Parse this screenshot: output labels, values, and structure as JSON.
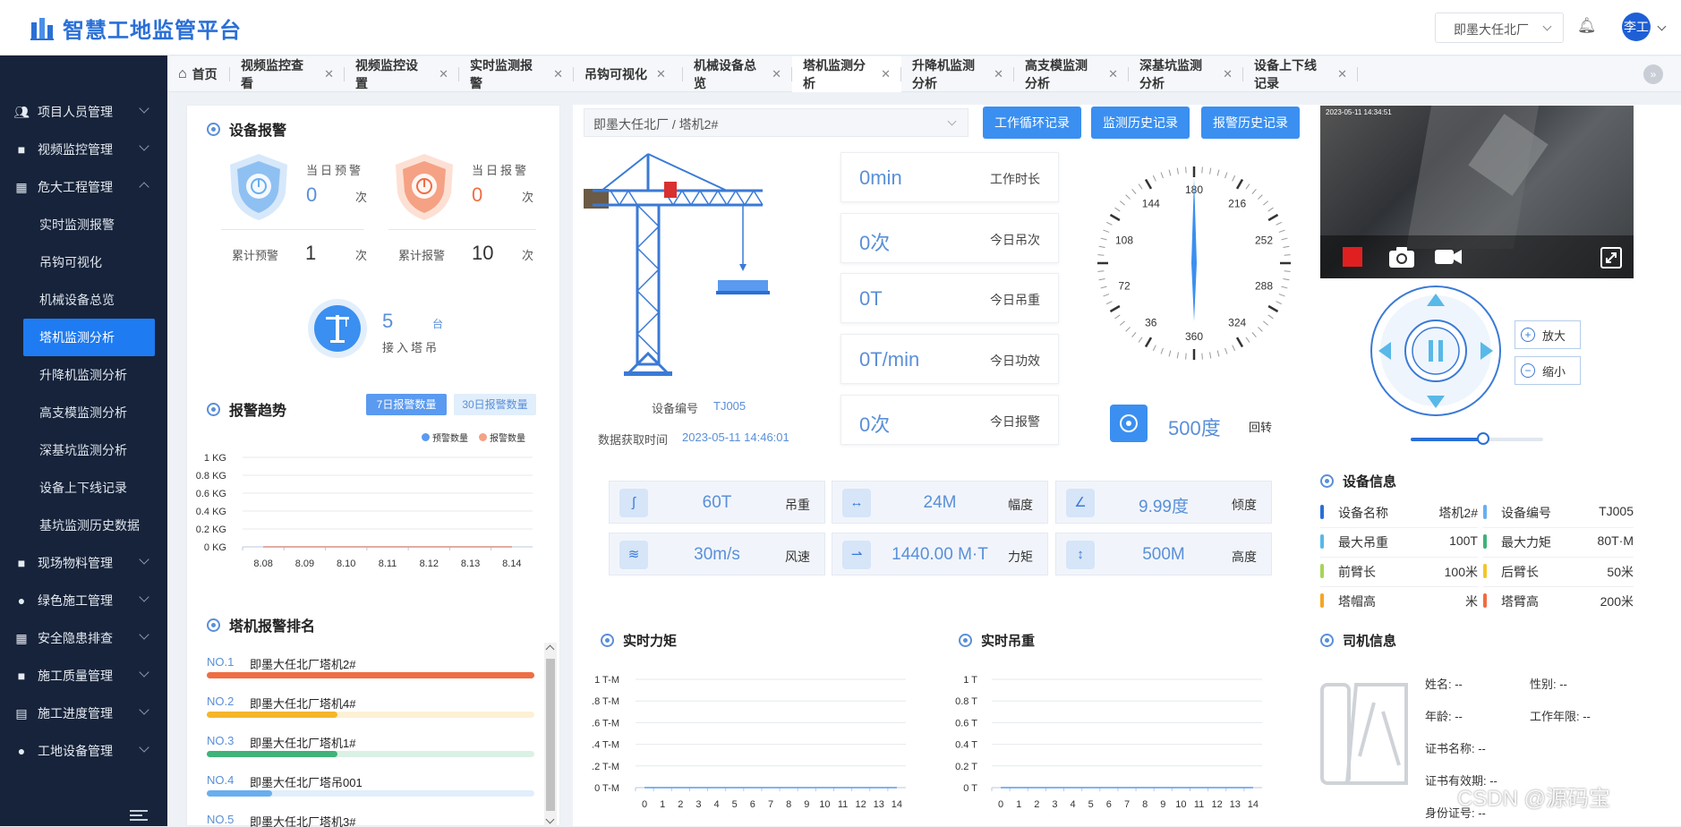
{
  "header": {
    "brand": "智慧工地监管平台",
    "site_select": "即墨大任北厂",
    "user": "李工"
  },
  "sidebar": {
    "items": [
      {
        "label": "项目人员管理",
        "icon": "people-icon",
        "expanded": false
      },
      {
        "label": "视频监控管理",
        "icon": "cube-icon",
        "expanded": false
      },
      {
        "label": "危大工程管理",
        "icon": "building-icon",
        "expanded": true
      }
    ],
    "sub_items": [
      "实时监测报警",
      "吊钩可视化",
      "机械设备总览",
      "塔机监测分析",
      "升降机监测分析",
      "高支模监测分析",
      "深基坑监测分析",
      "设备上下线记录",
      "基坑监测历史数据"
    ],
    "active_sub": "塔机监测分析",
    "more_items": [
      {
        "label": "现场物料管理",
        "icon": "cube-icon"
      },
      {
        "label": "绿色施工管理",
        "icon": "person-icon"
      },
      {
        "label": "安全隐患排查",
        "icon": "building-icon"
      },
      {
        "label": "施工质量管理",
        "icon": "cube-icon"
      },
      {
        "label": "施工进度管理",
        "icon": "schedule-icon"
      },
      {
        "label": "工地设备管理",
        "icon": "person-icon"
      }
    ]
  },
  "tabs": [
    {
      "label": "首页",
      "closable": false
    },
    {
      "label": "视频监控查看",
      "closable": true
    },
    {
      "label": "视频监控设置",
      "closable": true
    },
    {
      "label": "实时监测报警",
      "closable": true
    },
    {
      "label": "吊钩可视化",
      "closable": true
    },
    {
      "label": "机械设备总览",
      "closable": true
    },
    {
      "label": "塔机监测分析",
      "closable": true,
      "active": true
    },
    {
      "label": "升降机监测分析",
      "closable": true
    },
    {
      "label": "高支模监测分析",
      "closable": true
    },
    {
      "label": "深基坑监测分析",
      "closable": true
    },
    {
      "label": "设备上下线记录",
      "closable": true
    }
  ],
  "alarm": {
    "title": "设备报警",
    "daily_warning_label": "当日预警",
    "daily_warning_value": "0",
    "daily_alarm_label": "当日报警",
    "daily_alarm_value": "0",
    "unit": "次",
    "total_warning_label": "累计预警",
    "total_warning_value": "1",
    "total_alarm_label": "累计报警",
    "total_alarm_value": "10",
    "cranes_value": "5",
    "cranes_unit": "台",
    "cranes_label": "接入塔吊"
  },
  "trend": {
    "title": "报警趋势",
    "btn_7": "7日报警数量",
    "btn_30": "30日报警数量",
    "legend_warning": "预警数量",
    "legend_alarm": "报警数量"
  },
  "chart_data": [
    {
      "type": "line",
      "categories": [
        "8.08",
        "8.09",
        "8.10",
        "8.11",
        "8.12",
        "8.13",
        "8.14"
      ],
      "series": [
        {
          "name": "预警数量",
          "values": [
            0,
            0,
            0,
            0,
            0,
            0,
            0
          ]
        },
        {
          "name": "报警数量",
          "values": [
            0,
            0,
            0,
            0,
            0,
            0,
            0
          ]
        }
      ],
      "yticks": [
        "1 KG",
        "0.8 KG",
        "0.6 KG",
        "0.4 KG",
        "0.2 KG",
        "0 KG"
      ],
      "title": "报警趋势",
      "ylim": [
        0,
        1
      ]
    },
    {
      "type": "line",
      "categories": [
        "0",
        "1",
        "2",
        "3",
        "4",
        "5",
        "6",
        "7",
        "8",
        "9",
        "10",
        "11",
        "12",
        "13",
        "14"
      ],
      "series": [
        {
          "values": [
            0,
            0,
            0,
            0,
            0,
            0,
            0,
            0,
            0,
            0,
            0,
            0,
            0,
            0,
            0
          ]
        }
      ],
      "yticks": [
        "1 T-M",
        ".8 T-M",
        ".6 T-M",
        ".4 T-M",
        ".2 T-M",
        "0 T-M"
      ],
      "title": "实时力矩",
      "ylim": [
        0,
        1
      ]
    },
    {
      "type": "line",
      "categories": [
        "0",
        "1",
        "2",
        "3",
        "4",
        "5",
        "6",
        "7",
        "8",
        "9",
        "10",
        "11",
        "12",
        "13",
        "14"
      ],
      "series": [
        {
          "values": [
            0,
            0,
            0,
            0,
            0,
            0,
            0,
            0,
            0,
            0,
            0,
            0,
            0,
            0,
            0
          ]
        }
      ],
      "yticks": [
        "1 T",
        "0.8 T",
        "0.6 T",
        "0.4 T",
        "0.2 T",
        "0 T"
      ],
      "title": "实时吊重",
      "ylim": [
        0,
        1
      ]
    }
  ],
  "ranking": {
    "title": "塔机报警排名",
    "items": [
      {
        "no": "NO.1",
        "name": "即墨大任北厂塔机2#",
        "ratio": 1.0,
        "color": "#f06d43",
        "track": "#fde3d8"
      },
      {
        "no": "NO.2",
        "name": "即墨大任北厂塔机4#",
        "ratio": 0.4,
        "color": "#f5b62b",
        "track": "#fdf1d4"
      },
      {
        "no": "NO.3",
        "name": "即墨大任北厂塔机1#",
        "ratio": 0.4,
        "color": "#3fb37a",
        "track": "#dbf1e5"
      },
      {
        "no": "NO.4",
        "name": "即墨大任北厂塔吊001",
        "ratio": 0.2,
        "color": "#6aaef0",
        "track": "#e1eefb"
      },
      {
        "no": "NO.5",
        "name": "即墨大任北厂塔机3#",
        "ratio": 0.1,
        "color": "#9b7de0",
        "track": "#eee8fa"
      }
    ]
  },
  "crane": {
    "breadcrumb": "即墨大任北厂 / 塔机2#",
    "btn_cycle": "工作循环记录",
    "btn_history": "监测历史记录",
    "btn_alarm": "报警历史记录",
    "device_no_label": "设备编号",
    "device_no": "TJ005",
    "time_label": "数据获取时间",
    "time": "2023-05-11 14:46:01",
    "rotation_value": "500度",
    "rotation_label": "回转",
    "compass_marks": [
      "180",
      "216",
      "252",
      "288",
      "324",
      "360",
      "36",
      "72",
      "108",
      "144"
    ]
  },
  "stats": [
    {
      "value": "0min",
      "label": "工作时长"
    },
    {
      "value": "0次",
      "label": "今日吊次"
    },
    {
      "value": "0T",
      "label": "今日吊重"
    },
    {
      "value": "0T/min",
      "label": "今日功效"
    },
    {
      "value": "0次",
      "label": "今日报警"
    }
  ],
  "params": [
    {
      "value": "60T",
      "label": "吊重",
      "icon": "hook-icon"
    },
    {
      "value": "24M",
      "label": "幅度",
      "icon": "width-icon"
    },
    {
      "value": "9.99度",
      "label": "倾度",
      "icon": "angle-icon"
    },
    {
      "value": "30m/s",
      "label": "风速",
      "icon": "wind-icon"
    },
    {
      "value": "1440.00 M·T",
      "label": "力矩",
      "icon": "torque-icon"
    },
    {
      "value": "500M",
      "label": "高度",
      "icon": "height-icon"
    }
  ],
  "charts": {
    "torque_title": "实时力矩",
    "load_title": "实时吊重"
  },
  "video": {
    "timestamp": "2023-05-11 14:34:51",
    "zoom_in": "放大",
    "zoom_out": "缩小",
    "slider_level": 0.55
  },
  "device_info": {
    "title": "设备信息",
    "rows": [
      {
        "k": "设备名称",
        "v": "塔机2#",
        "color": "#2a6fd6"
      },
      {
        "k": "设备编号",
        "v": "TJ005",
        "color": "#6aaef0"
      },
      {
        "k": "最大吊重",
        "v": "100T",
        "color": "#58b8e8"
      },
      {
        "k": "最大力矩",
        "v": "80T·M",
        "color": "#3fb37a"
      },
      {
        "k": "前臂长",
        "v": "100米",
        "color": "#a6d45a"
      },
      {
        "k": "后臂长",
        "v": "50米",
        "color": "#f5c52b"
      },
      {
        "k": "塔帽高",
        "v": "米",
        "color": "#f5a623"
      },
      {
        "k": "塔臂高",
        "v": "200米",
        "color": "#f06d43"
      }
    ]
  },
  "driver": {
    "title": "司机信息",
    "name": "姓名: --",
    "gender": "性别: --",
    "age": "年龄: --",
    "years": "工作年限: --",
    "cert": "证书名称: --",
    "valid": "证书有效期: --",
    "idno": "身份证号: --"
  },
  "watermark": "CSDN @源码宝"
}
